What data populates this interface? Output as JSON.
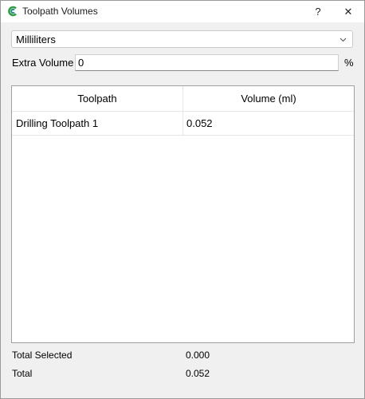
{
  "window": {
    "title": "Toolpath Volumes",
    "help_label": "?",
    "close_label": "✕"
  },
  "unit_select": {
    "selected": "Milliliters"
  },
  "extra_volume": {
    "label": "Extra Volume",
    "value": "0",
    "unit": "%"
  },
  "table": {
    "columns": [
      "Toolpath",
      "Volume (ml)"
    ],
    "rows": [
      {
        "toolpath": "Drilling Toolpath 1",
        "volume": "0.052"
      }
    ]
  },
  "totals": {
    "selected_label": "Total Selected",
    "selected_value": "0.000",
    "total_label": "Total",
    "total_value": "0.052"
  },
  "colors": {
    "app_icon_green": "#2e9e3e",
    "app_icon_teal": "#1f7f8a"
  },
  "icons": {
    "app": "app-logo-icon",
    "dropdown": "chevron-down-icon"
  }
}
